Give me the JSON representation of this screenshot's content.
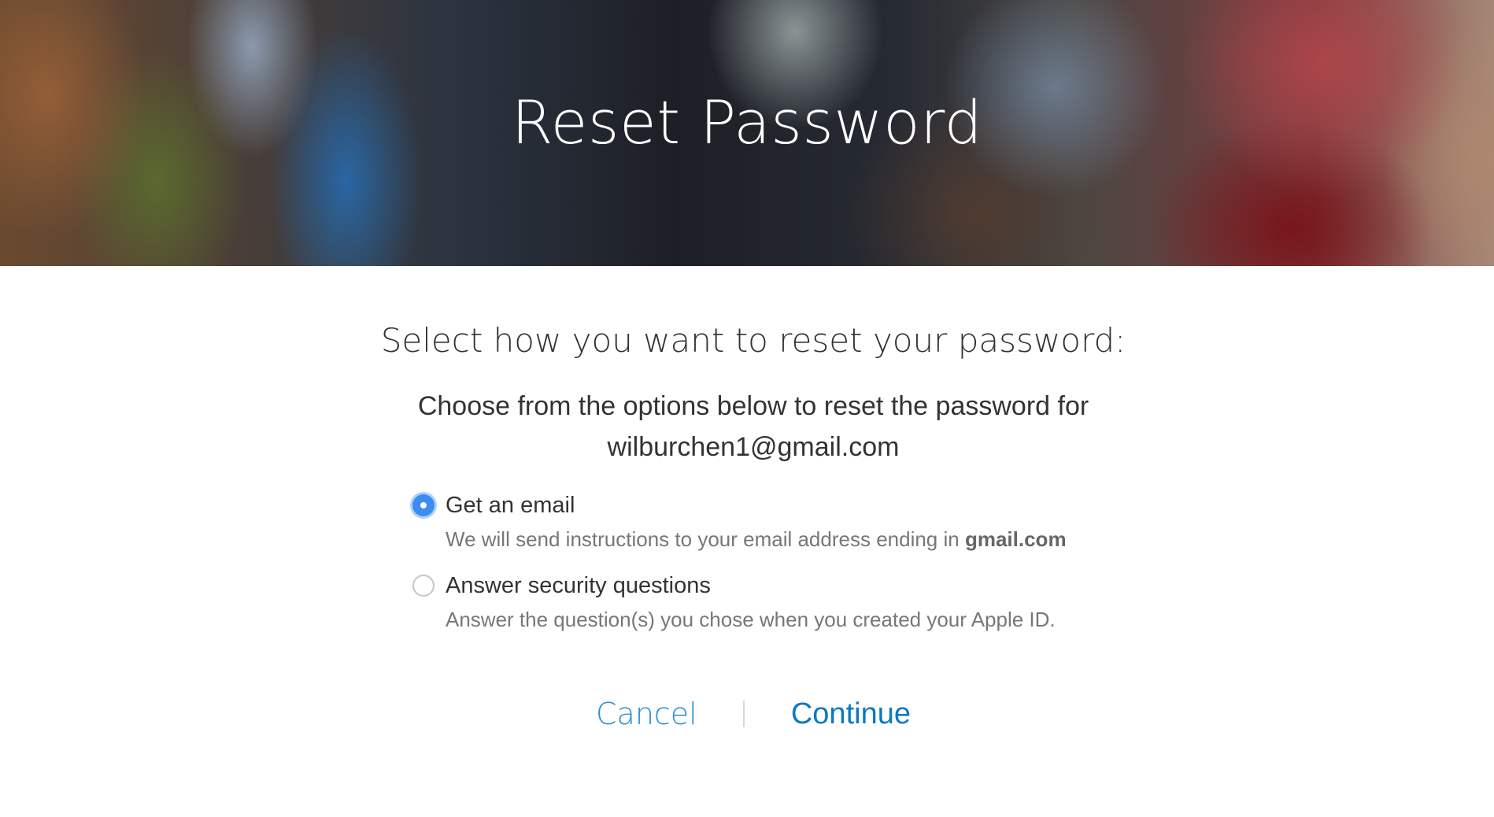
{
  "hero": {
    "title": "Reset Password"
  },
  "main": {
    "subtitle": "Select how you want to reset your password:",
    "instructions_text": "Choose from the options below to reset the password for",
    "account_email": "wilburchen1@gmail.com"
  },
  "options": [
    {
      "label": "Get an email",
      "description": "We will send instructions to your email address ending in",
      "description_emphasis": "gmail.com",
      "selected": true
    },
    {
      "label": "Answer security questions",
      "description": "Answer the question(s) you chose when you created your Apple ID.",
      "selected": false
    }
  ],
  "actions": {
    "cancel_label": "Cancel",
    "continue_label": "Continue"
  },
  "colors": {
    "accent": "#0070c9",
    "radio_selected": "#3b8df0"
  }
}
